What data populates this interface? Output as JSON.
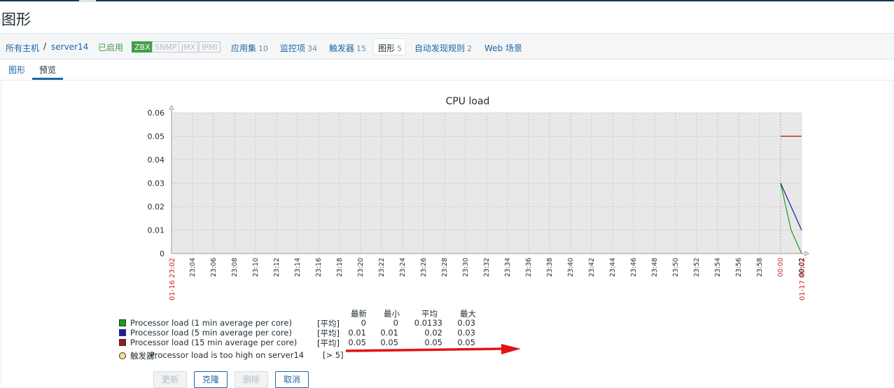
{
  "page": {
    "title": "图形"
  },
  "nav": {
    "all_hosts": "所有主机",
    "separator": "/",
    "host": "server14",
    "status": "已启用",
    "badges": [
      {
        "label": "ZBX",
        "active": true
      },
      {
        "label": "SNMP",
        "active": false
      },
      {
        "label": "JMX",
        "active": false
      },
      {
        "label": "IPMI",
        "active": false
      }
    ],
    "links": [
      {
        "label": "应用集",
        "count": "10"
      },
      {
        "label": "监控项",
        "count": "34"
      },
      {
        "label": "触发器",
        "count": "15"
      },
      {
        "label": "图形",
        "count": "5"
      },
      {
        "label": "自动发现规则",
        "count": "2"
      },
      {
        "label": "Web 场景",
        "count": ""
      }
    ]
  },
  "subtabs": [
    {
      "label": "图形",
      "active": false
    },
    {
      "label": "预览",
      "active": true
    }
  ],
  "chart_data": {
    "type": "line",
    "title": "CPU load",
    "ylim": [
      0,
      0.06
    ],
    "yticks": [
      "0.06",
      "0.05",
      "0.04",
      "0.03",
      "0.02",
      "0.01",
      "0"
    ],
    "xticks": [
      "23:04",
      "23:06",
      "23:08",
      "23:10",
      "23:12",
      "23:14",
      "23:16",
      "23:18",
      "23:20",
      "23:22",
      "23:24",
      "23:26",
      "23:28",
      "23:30",
      "23:32",
      "23:34",
      "23:36",
      "23:38",
      "23:40",
      "23:42",
      "23:44",
      "23:46",
      "23:48",
      "23:50",
      "23:52",
      "23:54",
      "23:56",
      "23:58",
      "00:00",
      "00:02"
    ],
    "x_start_label": "01-16 23:02",
    "x_end_label": "01-17 00:02",
    "grid": true,
    "series": [
      {
        "name": "Processor load (1 min average per core)",
        "color": "#1a9c1a",
        "x": [
          "00:00",
          "00:01",
          "00:02",
          "00:02"
        ],
        "values": [
          0.03,
          0.01,
          0,
          0
        ]
      },
      {
        "name": "Processor load (5 min average per core)",
        "color": "#1a1aa8",
        "x": [
          "00:00",
          "00:01",
          "00:02",
          "00:02"
        ],
        "values": [
          0.03,
          0.02,
          0.01,
          0.01
        ]
      },
      {
        "name": "Processor load (15 min average per core)",
        "color": "#9e1a1a",
        "x": [
          "00:00",
          "00:02"
        ],
        "values": [
          0.05,
          0.05
        ]
      }
    ]
  },
  "legend": {
    "headers": [
      "最新",
      "最小",
      "平均",
      "最大"
    ],
    "fn_label": "[平均]",
    "rows": [
      {
        "name": "Processor load (1 min average per core)",
        "color": "#1a9c1a",
        "values": [
          "0",
          "0",
          "0.0133",
          "0.03"
        ]
      },
      {
        "name": "Processor load (5 min average per core)",
        "color": "#1a1aa8",
        "values": [
          "0.01",
          "0.01",
          "0.02",
          "0.03"
        ]
      },
      {
        "name": "Processor load (15 min average per core)",
        "color": "#9e1a1a",
        "values": [
          "0.05",
          "0.05",
          "0.05",
          "0.05"
        ]
      }
    ],
    "trigger": {
      "prefix": "触发器:",
      "text": "Processor load is too high on server14",
      "threshold": "[> 5]"
    }
  },
  "buttons": [
    {
      "label": "更新",
      "disabled": true
    },
    {
      "label": "克隆",
      "disabled": false
    },
    {
      "label": "删除",
      "disabled": true
    },
    {
      "label": "取消",
      "disabled": false
    }
  ],
  "annotation": {
    "arrow_color": "#e31414"
  }
}
